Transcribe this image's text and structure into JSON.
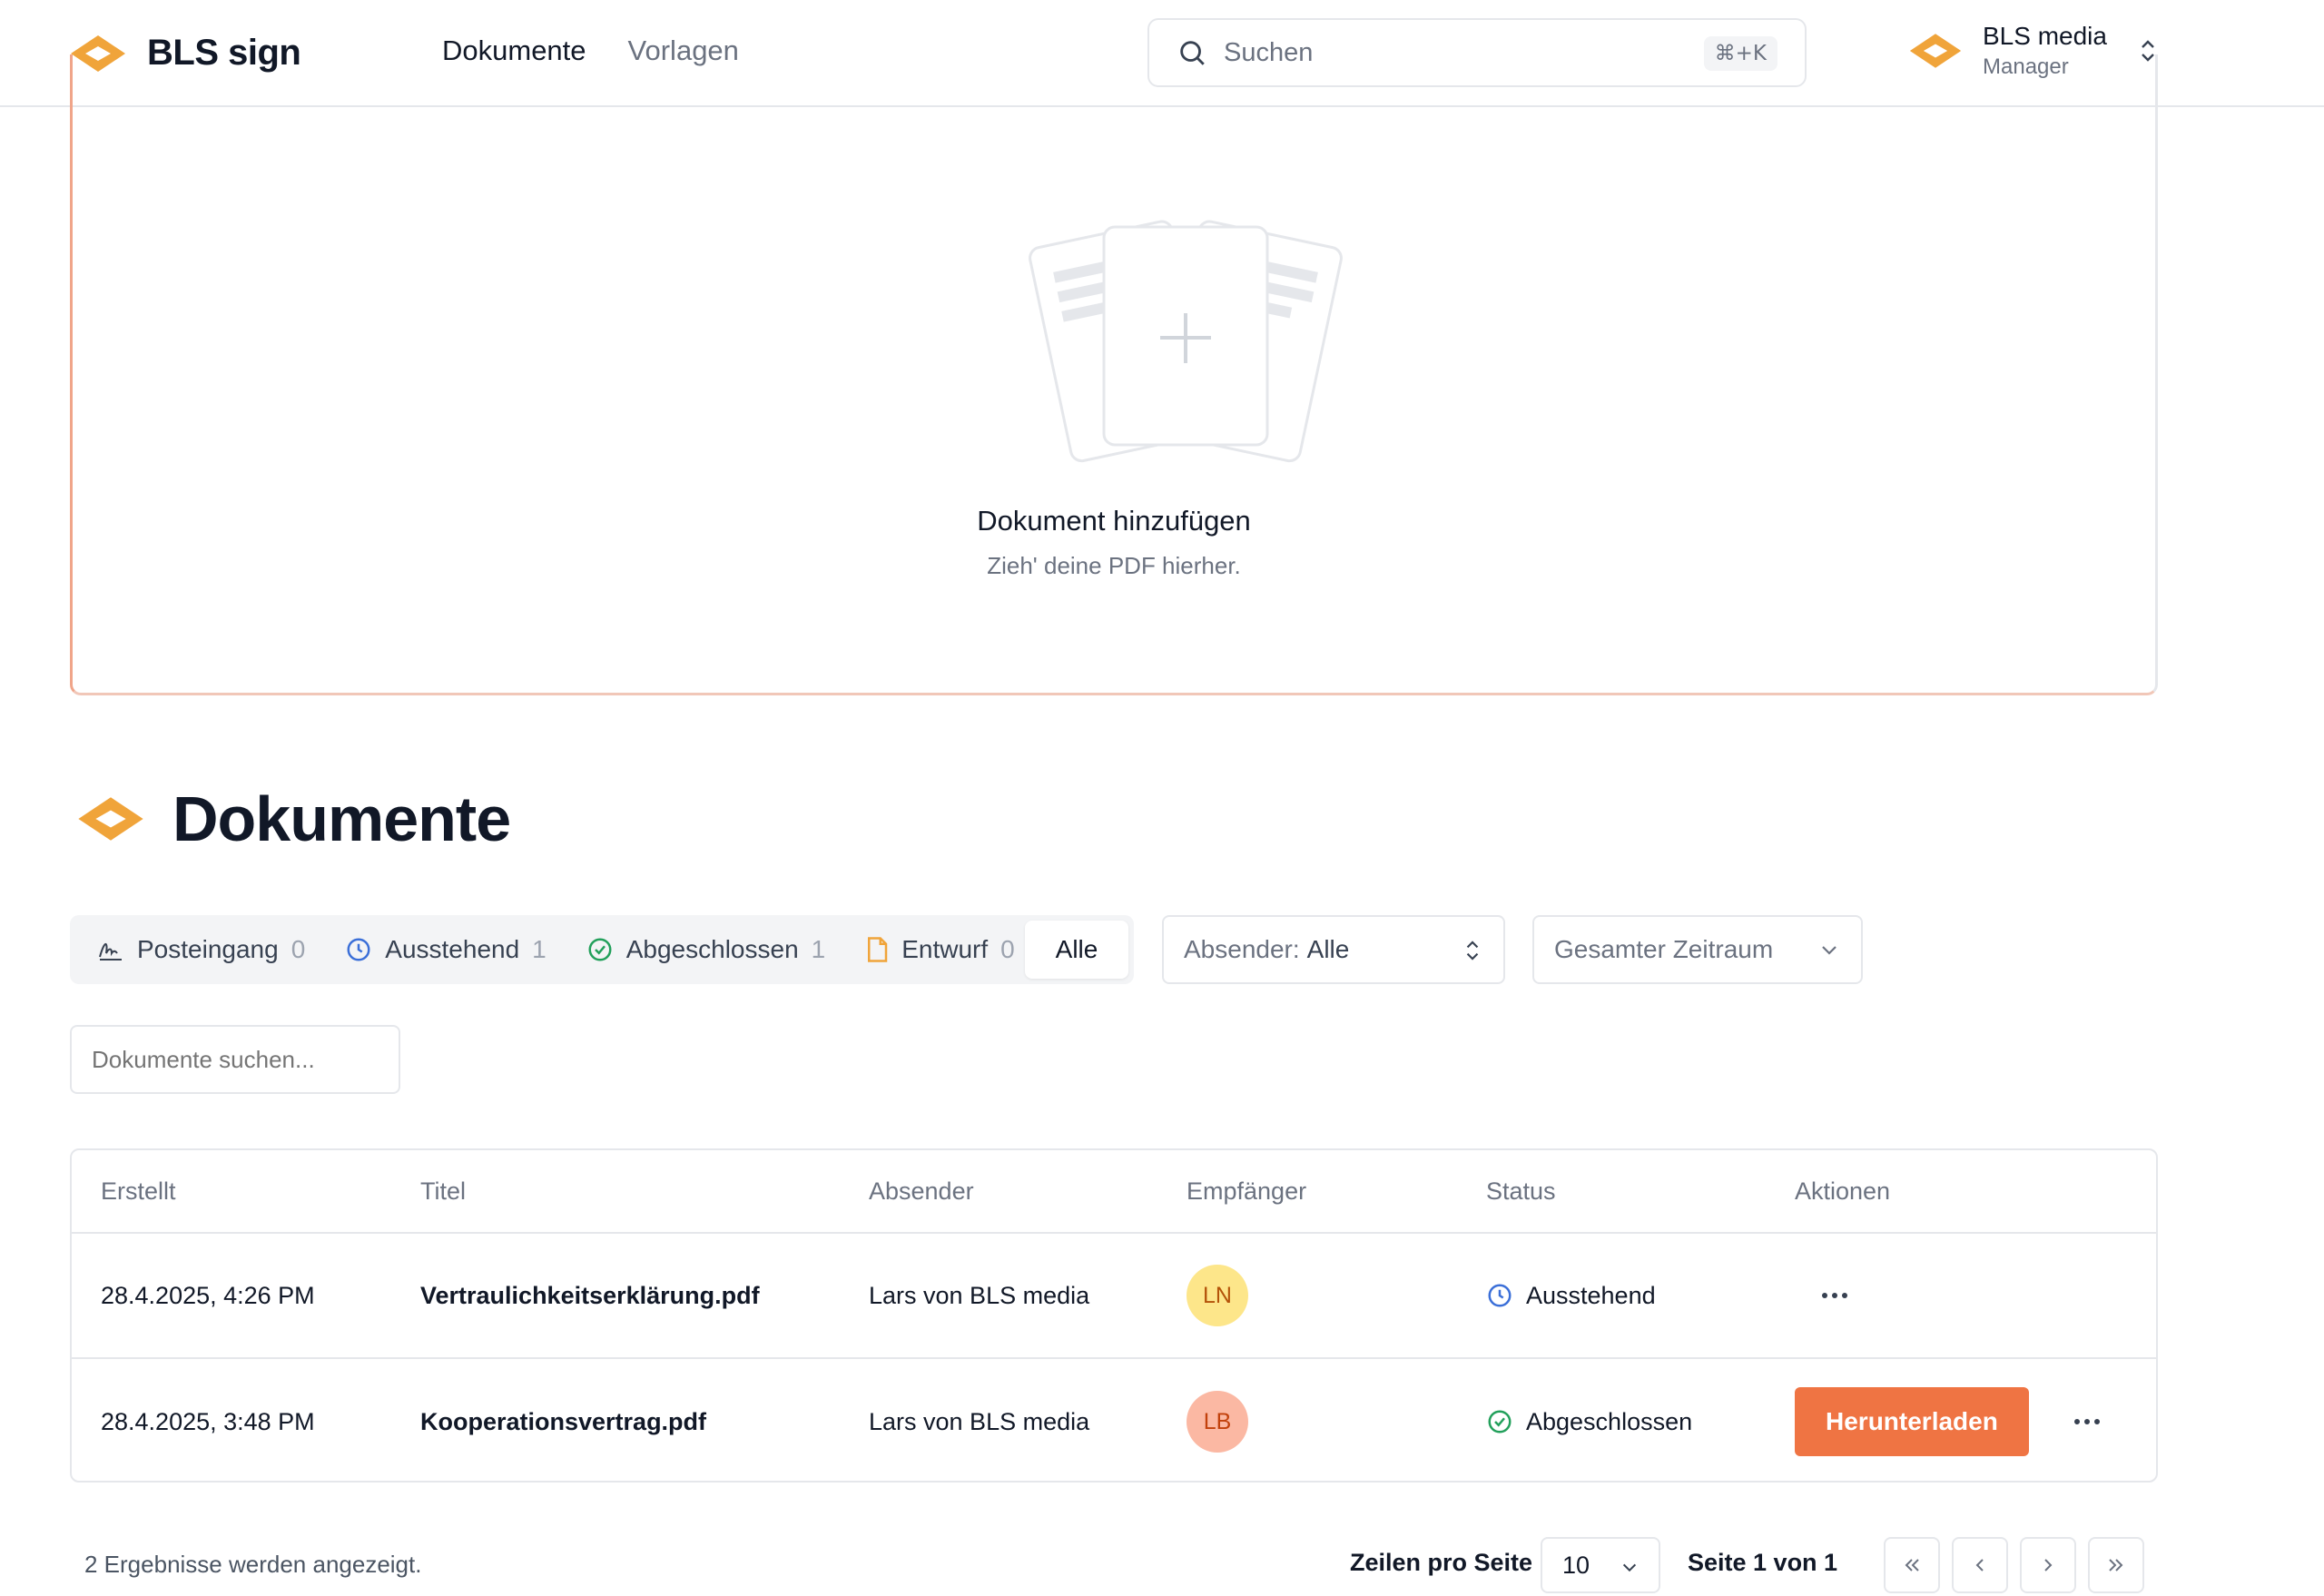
{
  "header": {
    "brand": "BLS sign",
    "nav": [
      "Dokumente",
      "Vorlagen"
    ],
    "search_placeholder": "Suchen",
    "search_shortcut": "⌘+K",
    "account_name": "BLS media",
    "account_role": "Manager"
  },
  "dropzone": {
    "title": "Dokument hinzufügen",
    "subtitle": "Zieh' deine PDF hierher."
  },
  "page_title": "Dokumente",
  "filters": {
    "tabs": [
      {
        "label": "Posteingang",
        "count": "0",
        "icon": "signature-icon"
      },
      {
        "label": "Ausstehend",
        "count": "1",
        "icon": "clock-icon"
      },
      {
        "label": "Abgeschlossen",
        "count": "1",
        "icon": "check-circle-icon"
      },
      {
        "label": "Entwurf",
        "count": "0",
        "icon": "file-icon"
      }
    ],
    "active_tab": "Alle",
    "sender_label": "Absender:",
    "sender_value": "Alle",
    "period": "Gesamter Zeitraum",
    "doc_search_placeholder": "Dokumente suchen..."
  },
  "table": {
    "headers": [
      "Erstellt",
      "Titel",
      "Absender",
      "Empfänger",
      "Status",
      "Aktionen"
    ],
    "rows": [
      {
        "created": "28.4.2025, 4:26 PM",
        "title": "Vertraulichkeitserklärung.pdf",
        "sender": "Lars von BLS media",
        "recipient": "LN",
        "status": "Ausstehend"
      },
      {
        "created": "28.4.2025, 3:48 PM",
        "title": "Kooperationsvertrag.pdf",
        "sender": "Lars von BLS media",
        "recipient": "LB",
        "status": "Abgeschlossen",
        "action": "Herunterladen"
      }
    ]
  },
  "pagination": {
    "results": "2 Ergebnisse werden angezeigt.",
    "rows_per_page_label": "Zeilen pro Seite",
    "rows_per_page": "10",
    "page_info": "Seite 1 von 1"
  },
  "colors": {
    "brand_orange": "#f0a43a",
    "accent": "#ef7443",
    "pending_blue": "#3b6fd8",
    "done_green": "#22a05b"
  }
}
